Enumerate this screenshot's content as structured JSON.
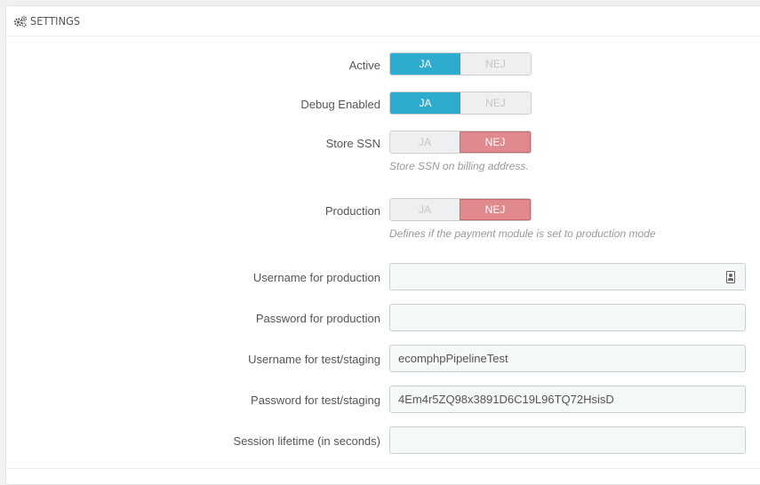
{
  "panel": {
    "title": "SETTINGS",
    "icon": "cogs-icon"
  },
  "toggles": {
    "active": {
      "label": "Active",
      "yes": "JA",
      "no": "NEJ",
      "value": "yes"
    },
    "debug": {
      "label": "Debug Enabled",
      "yes": "JA",
      "no": "NEJ",
      "value": "yes"
    },
    "store_ssn": {
      "label": "Store SSN",
      "yes": "JA",
      "no": "NEJ",
      "value": "no",
      "help": "Store SSN on billing address."
    },
    "production": {
      "label": "Production",
      "yes": "JA",
      "no": "NEJ",
      "value": "no",
      "help": "Defines if the payment module is set to production mode"
    }
  },
  "fields": {
    "username_production": {
      "label": "Username for production",
      "value": "",
      "icon": "contact-card-icon"
    },
    "password_production": {
      "label": "Password for production",
      "value": ""
    },
    "username_test": {
      "label": "Username for test/staging",
      "value": "ecomphpPipelineTest"
    },
    "password_test": {
      "label": "Password for test/staging",
      "value": "4Em4r5ZQ98x3891D6C19L96TQ72HsisD"
    },
    "session_lifetime": {
      "label": "Session lifetime (in seconds)",
      "value": ""
    }
  },
  "colors": {
    "yes_active": "#2eacce",
    "no_active": "#e08a8f"
  }
}
